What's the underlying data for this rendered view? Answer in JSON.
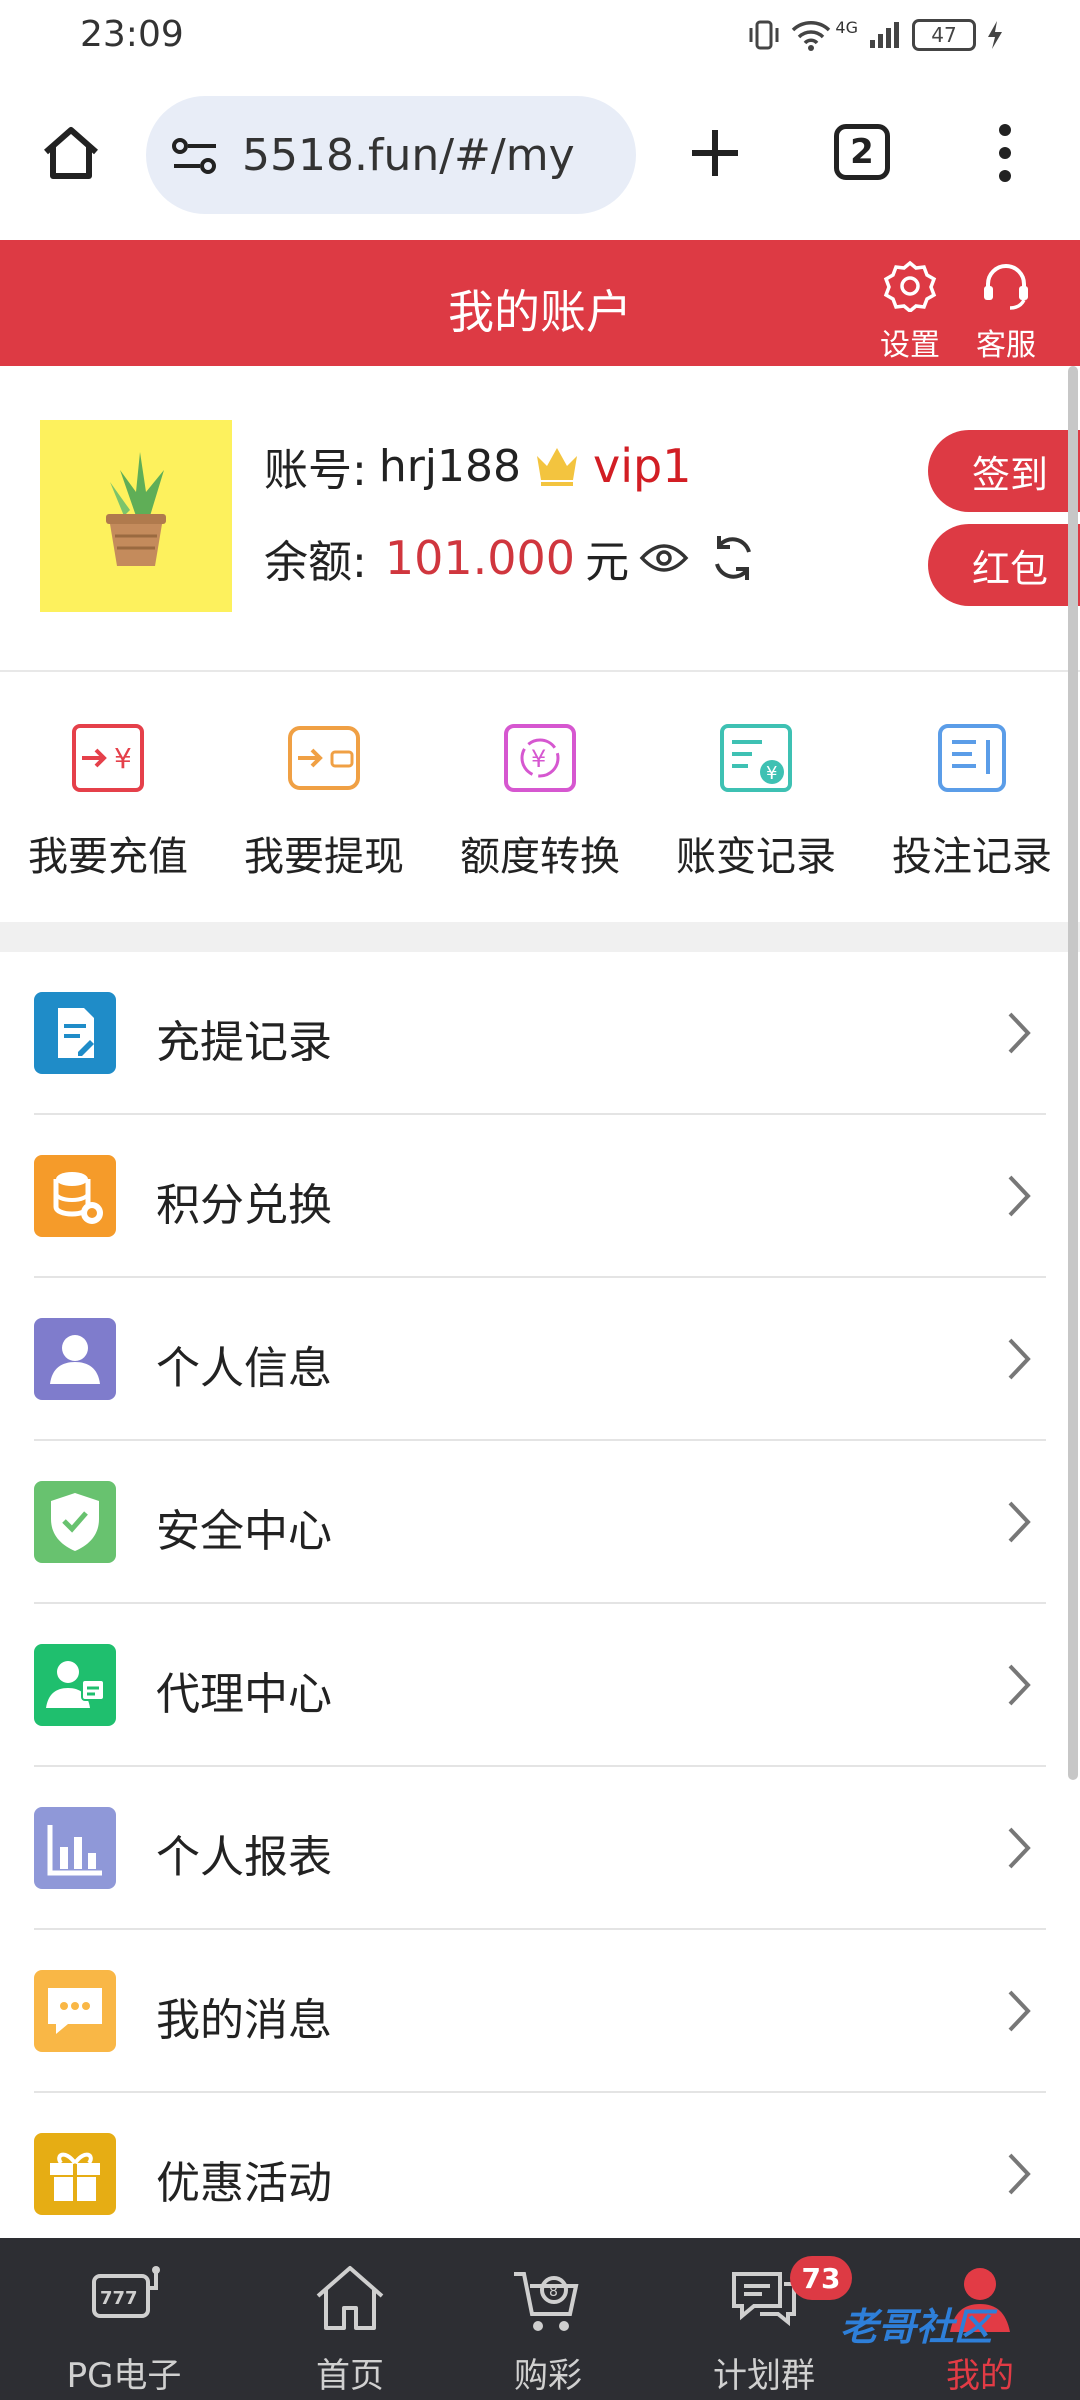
{
  "status_bar": {
    "time": "23:09",
    "network": "4G",
    "battery": "47"
  },
  "browser": {
    "url": "5518.fun/#/my",
    "tab_count": "2"
  },
  "header": {
    "title": "我的账户",
    "settings_label": "设置",
    "service_label": "客服"
  },
  "profile": {
    "account_label": "账号:",
    "account_name": "hrj188",
    "vip_level": "vip1",
    "balance_label": "余额:",
    "balance_value": "101.000",
    "currency": "元",
    "signin_label": "签到",
    "redpacket_label": "红包"
  },
  "quick_actions": [
    {
      "label": "我要充值",
      "icon": "deposit-icon",
      "color": "#e5404a"
    },
    {
      "label": "我要提现",
      "icon": "withdraw-icon",
      "color": "#f0a044"
    },
    {
      "label": "额度转换",
      "icon": "transfer-icon",
      "color": "#d657d0"
    },
    {
      "label": "账变记录",
      "icon": "account-change-icon",
      "color": "#3ec1b3"
    },
    {
      "label": "投注记录",
      "icon": "bet-record-icon",
      "color": "#5b9de8"
    }
  ],
  "menu": [
    {
      "label": "充提记录",
      "icon": "record-icon",
      "color": "#1f8cc8"
    },
    {
      "label": "积分兑换",
      "icon": "points-icon",
      "color": "#f59b2a"
    },
    {
      "label": "个人信息",
      "icon": "user-icon",
      "color": "#7f7ccc"
    },
    {
      "label": "安全中心",
      "icon": "shield-icon",
      "color": "#68c26f"
    },
    {
      "label": "代理中心",
      "icon": "agent-icon",
      "color": "#1fbf6e"
    },
    {
      "label": "个人报表",
      "icon": "chart-icon",
      "color": "#8f98d8"
    },
    {
      "label": "我的消息",
      "icon": "message-icon",
      "color": "#f9b746"
    },
    {
      "label": "优惠活动",
      "icon": "gift-icon",
      "color": "#e6ad14"
    }
  ],
  "bottom_nav": [
    {
      "label": "PG电子",
      "icon": "slot-machine-icon"
    },
    {
      "label": "首页",
      "icon": "home-icon"
    },
    {
      "label": "购彩",
      "icon": "lottery-cart-icon"
    },
    {
      "label": "计划群",
      "icon": "chat-group-icon",
      "badge": "73"
    },
    {
      "label": "我的",
      "icon": "profile-icon",
      "active": true
    }
  ],
  "watermark": "老哥社区"
}
